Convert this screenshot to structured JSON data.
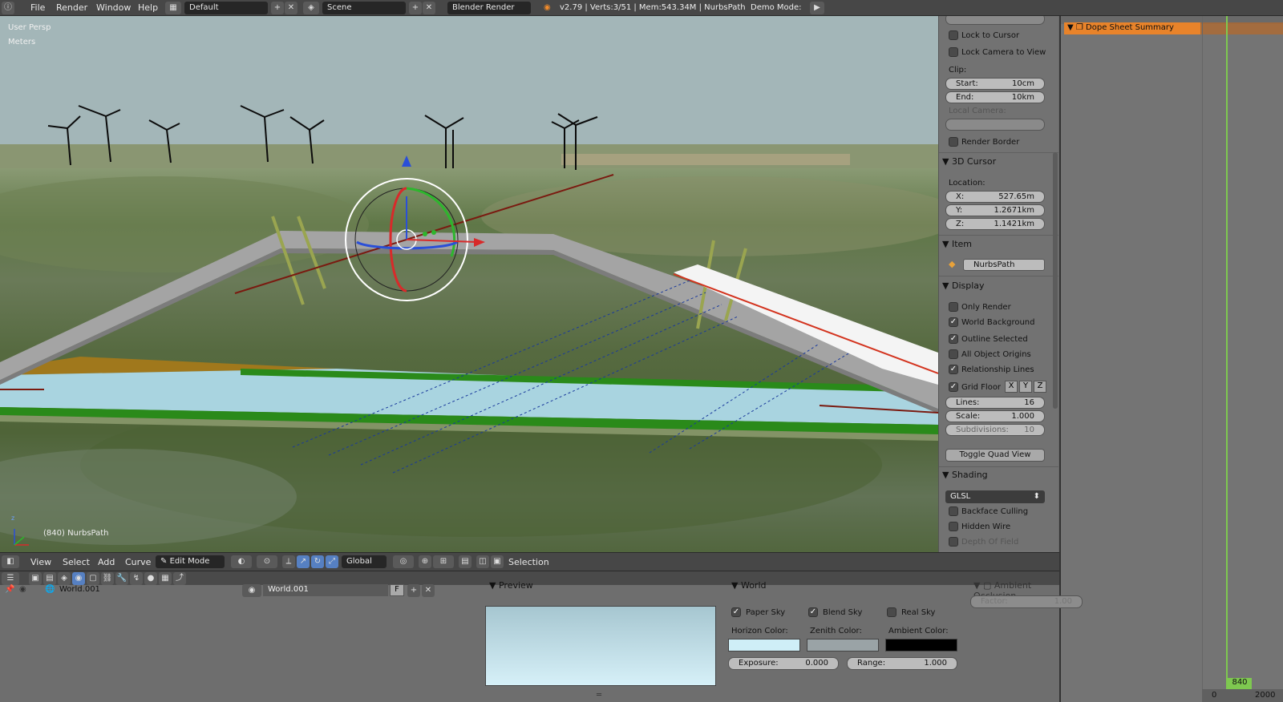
{
  "topbar": {
    "menus": [
      "File",
      "Render",
      "Window",
      "Help"
    ],
    "layout_name": "Default",
    "scene_name": "Scene",
    "render_engine": "Blender Render",
    "stats": "v2.79 | Verts:3/51 | Mem:543.34M | NurbsPath",
    "demo_mode": "Demo Mode:"
  },
  "viewport": {
    "view_name": "User Persp",
    "units": "Meters",
    "object_info": "(840) NurbsPath",
    "axes": {
      "z": "z",
      "y": "y",
      "x": "x"
    }
  },
  "npanel": {
    "lock_to_cursor": "Lock to Cursor",
    "lock_camera_to_view": "Lock Camera to View",
    "clip_label": "Clip:",
    "clip_start_label": "Start:",
    "clip_start_value": "10cm",
    "clip_end_label": "End:",
    "clip_end_value": "10km",
    "local_camera_label": "Local Camera:",
    "render_border": "Render Border",
    "cursor_section": "3D Cursor",
    "location_label": "Location:",
    "cursor_x_label": "X:",
    "cursor_x_value": "527.65m",
    "cursor_y_label": "Y:",
    "cursor_y_value": "1.2671km",
    "cursor_z_label": "Z:",
    "cursor_z_value": "1.1421km",
    "item_section": "Item",
    "item_name": "NurbsPath",
    "display_section": "Display",
    "display_checks": [
      {
        "label": "Only Render",
        "checked": false
      },
      {
        "label": "World Background",
        "checked": true
      },
      {
        "label": "Outline Selected",
        "checked": true
      },
      {
        "label": "All Object Origins",
        "checked": false
      },
      {
        "label": "Relationship Lines",
        "checked": true
      }
    ],
    "grid_floor": "Grid Floor",
    "grid_axes": [
      "X",
      "Y",
      "Z"
    ],
    "lines_label": "Lines:",
    "lines_value": "16",
    "scale_label": "Scale:",
    "scale_value": "1.000",
    "subdivisions_label": "Subdivisions:",
    "subdivisions_value": "10",
    "toggle_quad_view": "Toggle Quad View",
    "shading_section": "Shading",
    "shading_mode": "GLSL",
    "backface_culling": "Backface Culling",
    "hidden_wire": "Hidden Wire",
    "depth_of_field": "Depth Of Field"
  },
  "dopesheet": {
    "summary": "Dope Sheet Summary",
    "frame_current": "840",
    "frame_start": "0",
    "frame_end": "2000"
  },
  "vpheader": {
    "menus": [
      "View",
      "Select",
      "Add",
      "Curve"
    ],
    "mode": "Edit Mode",
    "orientation": "Global",
    "selection": "Selection"
  },
  "properties": {
    "world_name": "World.001",
    "world_datablock": "World.001",
    "fake_user": "F",
    "preview_section": "Preview",
    "world_section": "World",
    "paper_sky": "Paper Sky",
    "blend_sky": "Blend Sky",
    "real_sky": "Real Sky",
    "horizon_color_label": "Horizon Color:",
    "zenith_color_label": "Zenith Color:",
    "ambient_color_label": "Ambient Color:",
    "exposure_label": "Exposure:",
    "exposure_value": "0.000",
    "range_label": "Range:",
    "range_value": "1.000",
    "ao_section": "Ambient Occlusion",
    "factor_label": "Factor:",
    "factor_value": "1.00"
  },
  "colors": {
    "horizon": "#cfeef7",
    "zenith": "#9aa3a6",
    "ambient": "#000000",
    "accent_orange": "#e8832a",
    "timeline_green": "#7ec850"
  }
}
